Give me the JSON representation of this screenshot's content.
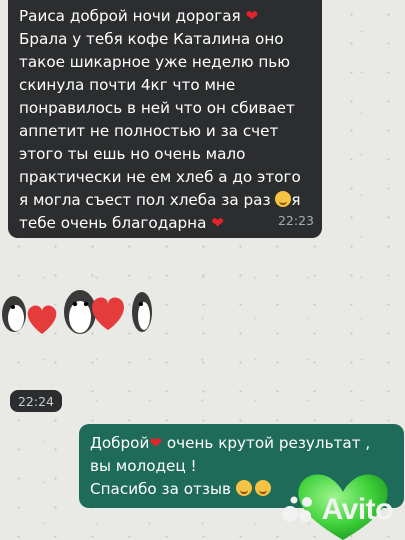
{
  "chat": {
    "incoming_message": {
      "lines": [
        "Раиса доброй ночи дорогая",
        "Брала у тебя кофе Каталина оно",
        "такое шикарное уже неделю пью",
        "скинула почти 4кг что мне",
        "понравилось в ней что он сбивает",
        "аппетит не полностью и за счет",
        "этого ты ешь но очень мало",
        "практически не ем хлеб а до этого",
        "я могла съест пол хлеба за раз",
        "я",
        "тебе очень благодарна"
      ],
      "time": "22:23"
    },
    "sticker_time": "22:24",
    "outgoing_message": {
      "line1_a": "Доброй",
      "line1_b": " очень крутой результат ,",
      "line2": "вы молодец !",
      "line3": "Спасибо за отзыв"
    }
  },
  "watermark": {
    "brand": "Avito"
  },
  "colors": {
    "incoming_bg": "#2b2d2f",
    "outgoing_bg": "#1f6b59",
    "heart_red": "#e3242b",
    "watermark_green": "#3fd13a"
  }
}
